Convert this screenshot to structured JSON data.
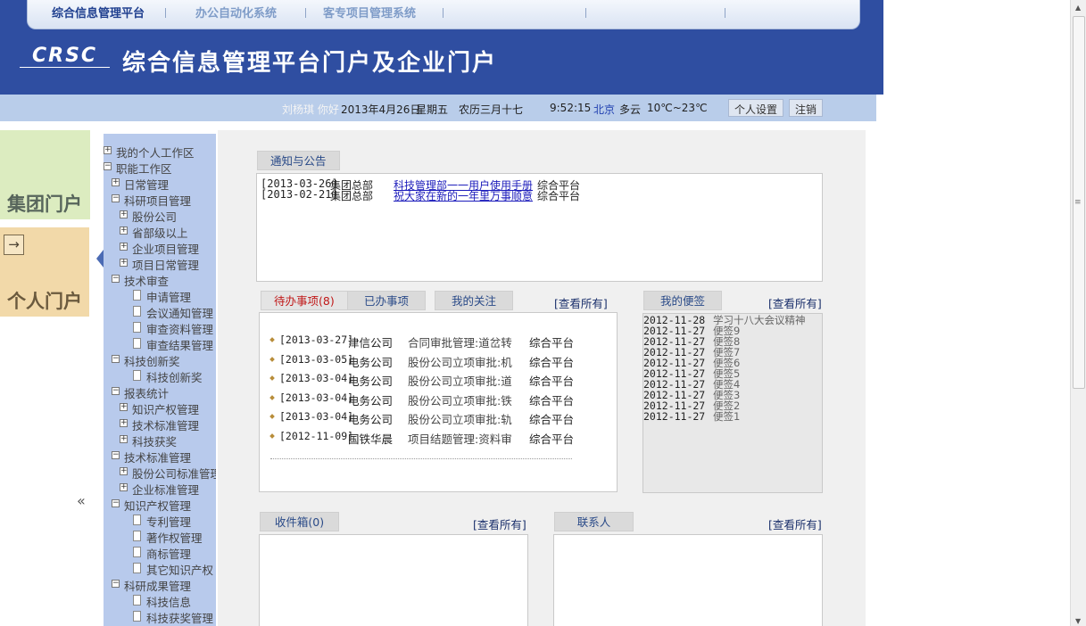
{
  "top_nav": {
    "tabs": [
      {
        "label": "综合信息管理平台"
      },
      {
        "label": "办公自动化系统"
      },
      {
        "label": "客专项目管理系统"
      }
    ]
  },
  "header": {
    "logo_text": "CRSC",
    "title": "综合信息管理平台门户及企业门户"
  },
  "status_bar": {
    "greeting": "刘杨琪 你好",
    "date": "2013年4月26日",
    "weekday": "星期五",
    "lunar": "农历三月十七",
    "time": "9:52:15",
    "city": "北京",
    "weather": "多云",
    "temperature": "10℃~23℃",
    "settings_button": "个人设置",
    "logout_button": "注销"
  },
  "left_portals": {
    "group_portal": "集团门户",
    "personal_portal": "个人门户",
    "arrow_glyph": "→",
    "collapse_glyph": "«"
  },
  "tree": [
    {
      "label": "我的个人工作区",
      "level": 0,
      "type": "plus"
    },
    {
      "label": "职能工作区",
      "level": 0,
      "type": "minus"
    },
    {
      "label": "日常管理",
      "level": 1,
      "type": "plus"
    },
    {
      "label": "科研项目管理",
      "level": 1,
      "type": "minus"
    },
    {
      "label": "股份公司",
      "level": 2,
      "type": "plus"
    },
    {
      "label": "省部级以上",
      "level": 2,
      "type": "plus"
    },
    {
      "label": "企业项目管理",
      "level": 2,
      "type": "plus"
    },
    {
      "label": "项目日常管理",
      "level": 2,
      "type": "plus"
    },
    {
      "label": "技术审查",
      "level": 1,
      "type": "minus"
    },
    {
      "label": "申请管理",
      "level": 3,
      "type": "doc"
    },
    {
      "label": "会议通知管理",
      "level": 3,
      "type": "doc"
    },
    {
      "label": "审查资料管理",
      "level": 3,
      "type": "doc"
    },
    {
      "label": "审查结果管理",
      "level": 3,
      "type": "doc"
    },
    {
      "label": "科技创新奖",
      "level": 1,
      "type": "minus"
    },
    {
      "label": "科技创新奖",
      "level": 3,
      "type": "doc"
    },
    {
      "label": "报表统计",
      "level": 1,
      "type": "minus"
    },
    {
      "label": "知识产权管理",
      "level": 2,
      "type": "plus"
    },
    {
      "label": "技术标准管理",
      "level": 2,
      "type": "plus"
    },
    {
      "label": "科技获奖",
      "level": 2,
      "type": "plus"
    },
    {
      "label": "技术标准管理",
      "level": 1,
      "type": "minus"
    },
    {
      "label": "股份公司标准管理",
      "level": 2,
      "type": "plus"
    },
    {
      "label": "企业标准管理",
      "level": 2,
      "type": "plus"
    },
    {
      "label": "知识产权管理",
      "level": 1,
      "type": "minus"
    },
    {
      "label": "专利管理",
      "level": 3,
      "type": "doc"
    },
    {
      "label": "著作权管理",
      "level": 3,
      "type": "doc"
    },
    {
      "label": "商标管理",
      "level": 3,
      "type": "doc"
    },
    {
      "label": "其它知识产权",
      "level": 3,
      "type": "doc"
    },
    {
      "label": "科研成果管理",
      "level": 1,
      "type": "minus"
    },
    {
      "label": "科技信息",
      "level": 3,
      "type": "doc"
    },
    {
      "label": "科技获奖管理",
      "level": 3,
      "type": "doc"
    }
  ],
  "notices": {
    "tab_label": "通知与公告",
    "items": [
      {
        "date": "[2013-03-26]",
        "org": "集团总部",
        "title": "科技管理部一一用户使用手册",
        "source": "综合平台"
      },
      {
        "date": "[2013-02-21]",
        "org": "集团总部",
        "title": "祝大家在新的一年里万事顺意",
        "source": "综合平台"
      }
    ]
  },
  "tasks": {
    "tabs": [
      {
        "label": "待办事项(8)"
      },
      {
        "label": "已办事项"
      },
      {
        "label": "我的关注"
      }
    ],
    "view_all": "[查看所有]",
    "items": [
      {
        "date": "[2013-03-27]",
        "org": "津信公司",
        "title": "合同审批管理:道岔转",
        "source": "综合平台"
      },
      {
        "date": "[2013-03-05]",
        "org": "电务公司",
        "title": "股份公司立项审批:机",
        "source": "综合平台"
      },
      {
        "date": "[2013-03-04]",
        "org": "电务公司",
        "title": "股份公司立项审批:道",
        "source": "综合平台"
      },
      {
        "date": "[2013-03-04]",
        "org": "电务公司",
        "title": "股份公司立项审批:铁",
        "source": "综合平台"
      },
      {
        "date": "[2013-03-04]",
        "org": "电务公司",
        "title": "股份公司立项审批:轨",
        "source": "综合平台"
      },
      {
        "date": "[2012-11-09]",
        "org": "国铁华晨",
        "title": "项目结题管理:资料审",
        "source": "综合平台"
      }
    ]
  },
  "memos": {
    "tab_label": "我的便签",
    "view_all": "[查看所有]",
    "items": [
      {
        "date": "2012-11-28",
        "text": "学习十八大会议精神"
      },
      {
        "date": "2012-11-27",
        "text": "便签9"
      },
      {
        "date": "2012-11-27",
        "text": "便签8"
      },
      {
        "date": "2012-11-27",
        "text": "便签7"
      },
      {
        "date": "2012-11-27",
        "text": "便签6"
      },
      {
        "date": "2012-11-27",
        "text": "便签5"
      },
      {
        "date": "2012-11-27",
        "text": "便签4"
      },
      {
        "date": "2012-11-27",
        "text": "便签3"
      },
      {
        "date": "2012-11-27",
        "text": "便签2"
      },
      {
        "date": "2012-11-27",
        "text": "便签1"
      }
    ]
  },
  "inbox": {
    "tab_label": "收件箱(0)",
    "view_all": "[查看所有]"
  },
  "contacts": {
    "tab_label": "联系人",
    "view_all": "[查看所有]"
  },
  "colors": {
    "header_bg": "#2f4ea1",
    "status_bg": "#b9cdea",
    "tree_bg": "#b8caec",
    "todo_tab_red": "#c01818"
  }
}
